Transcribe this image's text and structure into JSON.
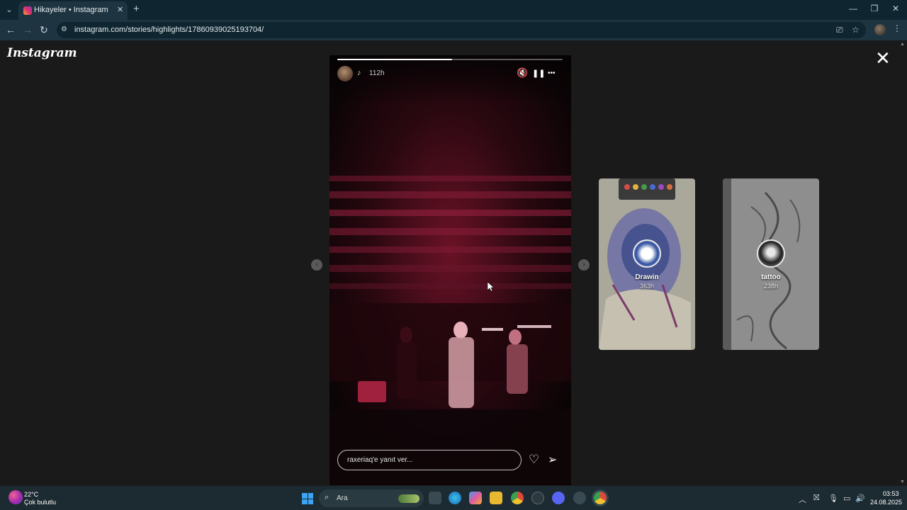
{
  "browser": {
    "tab_title": "Hikayeler • Instagram",
    "tab_close": "✕",
    "new_tab": "+",
    "tab_list": "⌄",
    "url": "instagram.com/stories/highlights/17860939025193704/",
    "window_controls": {
      "minimize": "—",
      "restore": "❐",
      "close": "✕"
    },
    "nav": {
      "back": "←",
      "forward": "→",
      "reload": "↻"
    },
    "omni_icons": {
      "site_info": "⚙",
      "install": "⎚",
      "bookmark": "☆"
    },
    "menu": "⋮"
  },
  "page": {
    "logo": "Instagram",
    "close": "✕"
  },
  "story": {
    "time": "112h",
    "user_icon": "♪",
    "progress_fraction": 0.51,
    "controls": {
      "mute": "🔇",
      "pause": "❚❚",
      "more": "•••"
    },
    "reply_placeholder": "raxeriaq'e yanıt ver...",
    "heart": "♡",
    "send": "➢",
    "prev": "‹",
    "next": "›"
  },
  "highlights": [
    {
      "title": "Drawin",
      "time": "363h"
    },
    {
      "title": "tattoo",
      "time": "238h"
    }
  ],
  "taskbar": {
    "weather_temp": "22°C",
    "weather_cond": "Çok bulutlu",
    "search_icon": "⌕",
    "search_placeholder": "Ara",
    "tray": {
      "chevron": "︿",
      "net1": "⛝",
      "mic": "🎙",
      "display": "▭",
      "volume": "🔊"
    },
    "clock_time": "03:53",
    "clock_date": "24.08.2025"
  },
  "colors": {
    "accent_taskbar": "#1c2a31",
    "browser_frame": "#0f2530",
    "story_stage_light": "#d0204a"
  }
}
